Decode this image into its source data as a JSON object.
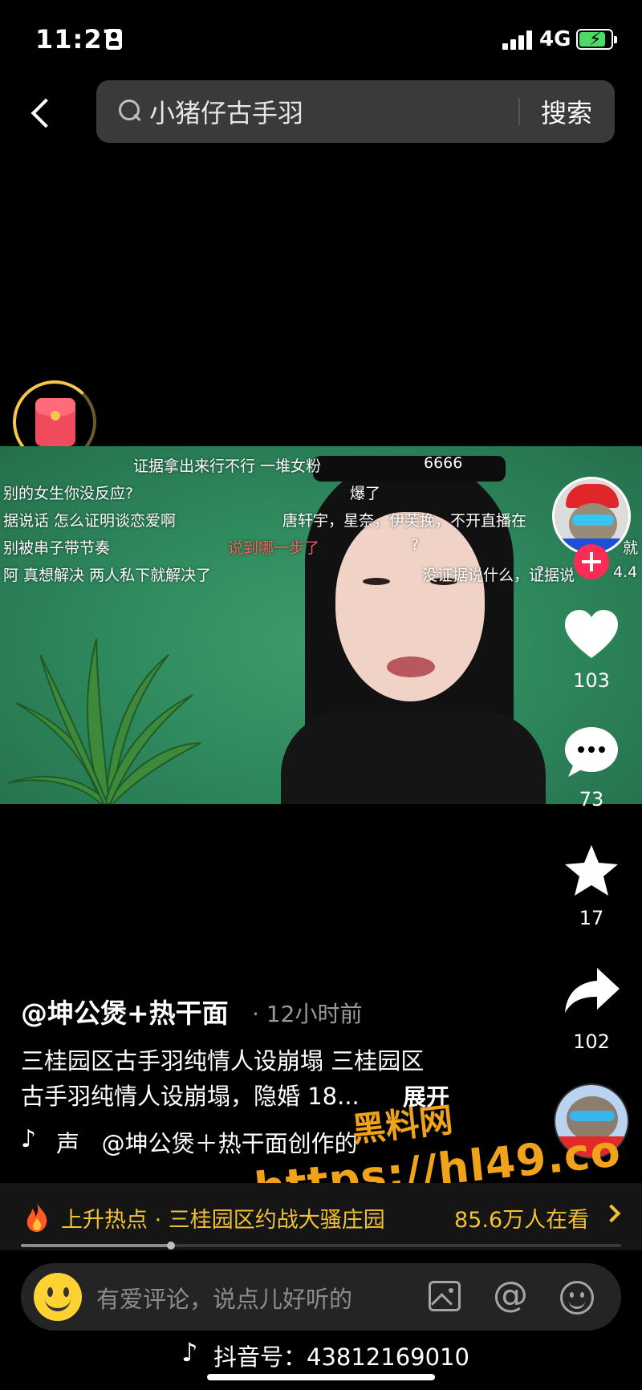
{
  "status_bar": {
    "time": "11:27",
    "network": "4G",
    "battery_level": 0.85
  },
  "search": {
    "query": "小猪仔古手羽",
    "button_label": "搜索"
  },
  "video": {
    "danmaku": [
      "证据拿出来行不行  一堆女粉",
      "6666",
      "别的女生你没反应?",
      "爆了",
      "据说话  怎么证明谈恋爱啊",
      "唐轩宇，星奈，伊芙挽，不开直播在",
      "别被串子带节奏",
      "说到哪一步了",
      "?",
      "就",
      "阿  真想解决  两人私下就解决了",
      "没证据说什么，证据说",
      "4.4",
      "?"
    ]
  },
  "actions": {
    "likes": "103",
    "comments": "73",
    "favorites": "17",
    "shares": "102"
  },
  "author": {
    "name": "@坤公煲+热干面",
    "time_sep": "·",
    "time": "12小时前",
    "caption_line1": "三桂园区古手羽纯情人设崩塌 三桂园区",
    "caption_line2": "古手羽纯情人设崩塌，隐婚 18...",
    "expand": "展开",
    "music_prefix": "声",
    "music_text": "@坤公煲＋热干面创作的"
  },
  "watermark": {
    "title": "黑料网",
    "url": "https://hl49.co"
  },
  "trending": {
    "label": "上升热点 · 三桂园区约战大骚庄园",
    "viewers": "85.6万人在看"
  },
  "progress": 0.25,
  "comment": {
    "placeholder": "有爱评论，说点儿好听的",
    "at_symbol": "@"
  },
  "footer": {
    "douyin_id": "抖音号：43812169010"
  },
  "colors": {
    "accent_red": "#fe2c55",
    "hot_yellow": "#f1c232",
    "watermark_orange": "#f0a319",
    "battery_green": "#4cd964"
  },
  "icons": [
    "back-icon",
    "search-icon",
    "red-packet-icon",
    "heart-icon",
    "comment-icon",
    "star-icon",
    "share-icon",
    "fire-icon",
    "smiley-icon",
    "image-icon",
    "at-icon",
    "emoji-icon",
    "tiktok-logo-icon"
  ]
}
